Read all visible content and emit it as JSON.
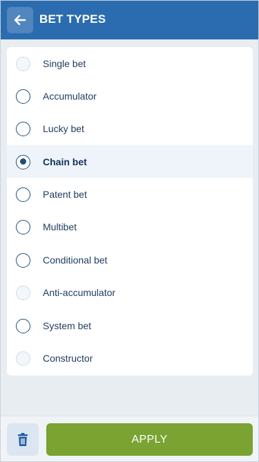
{
  "header": {
    "title": "BET TYPES",
    "back_icon": "arrow-left-icon",
    "color": "#2b6cb0"
  },
  "bet_types": [
    {
      "label": "Single bet",
      "state": "disabled"
    },
    {
      "label": "Accumulator",
      "state": "unchecked"
    },
    {
      "label": "Lucky bet",
      "state": "unchecked"
    },
    {
      "label": "Chain bet",
      "state": "checked"
    },
    {
      "label": "Patent bet",
      "state": "unchecked"
    },
    {
      "label": "Multibet",
      "state": "unchecked"
    },
    {
      "label": "Conditional bet",
      "state": "unchecked"
    },
    {
      "label": "Anti-accumulator",
      "state": "disabled"
    },
    {
      "label": "System bet",
      "state": "unchecked"
    },
    {
      "label": "Constructor",
      "state": "disabled"
    }
  ],
  "footer": {
    "trash_icon": "trash-icon",
    "apply_label": "APPLY",
    "apply_color": "#7aa332"
  }
}
